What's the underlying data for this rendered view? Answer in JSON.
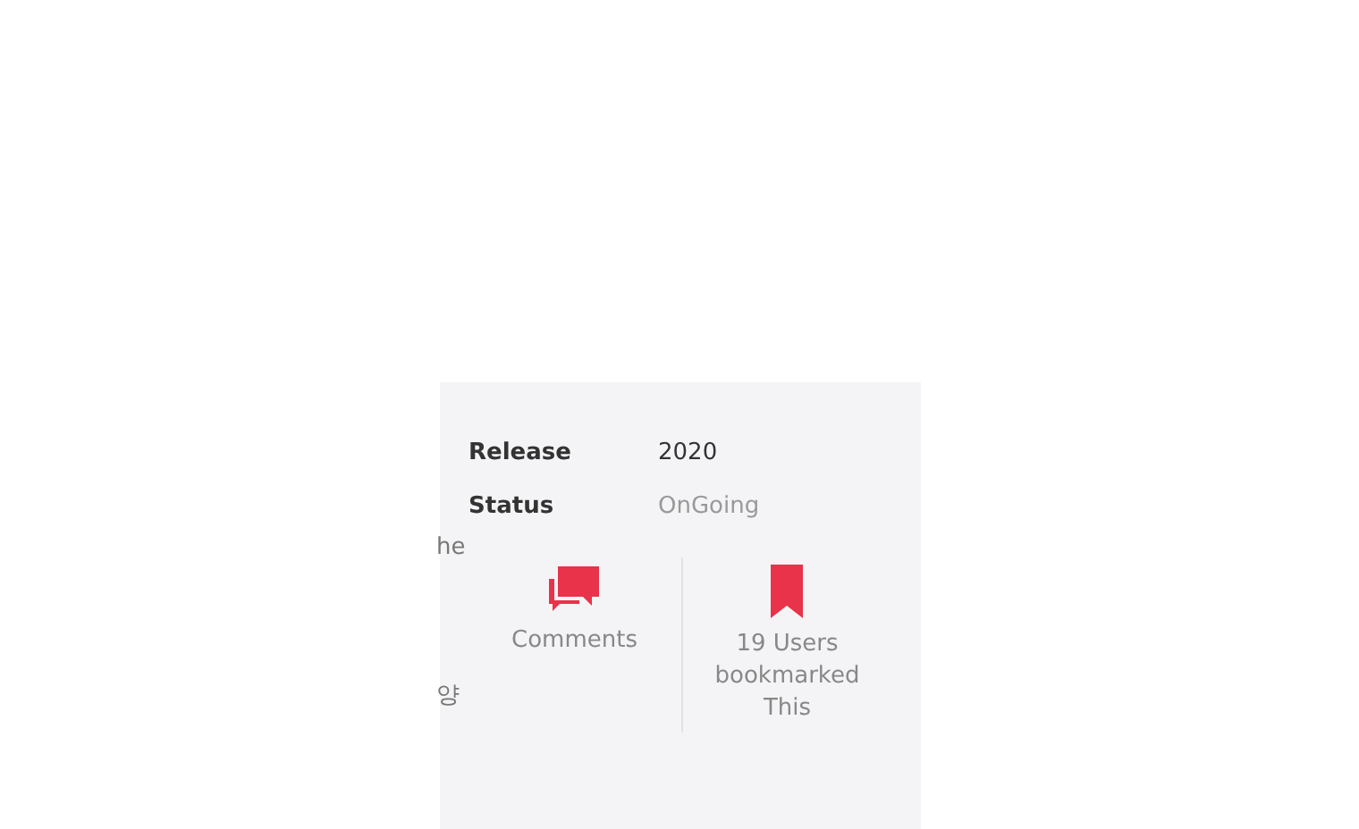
{
  "info": [
    {
      "label": "Release",
      "value": "2020",
      "muted": false
    },
    {
      "label": "Status",
      "value": "OnGoing",
      "muted": true
    }
  ],
  "fragments": [
    "he",
    "양"
  ],
  "actions": [
    {
      "kind": "comments",
      "label": "Comments"
    },
    {
      "kind": "bookmark",
      "label": "19 Users bookmarked This"
    }
  ]
}
